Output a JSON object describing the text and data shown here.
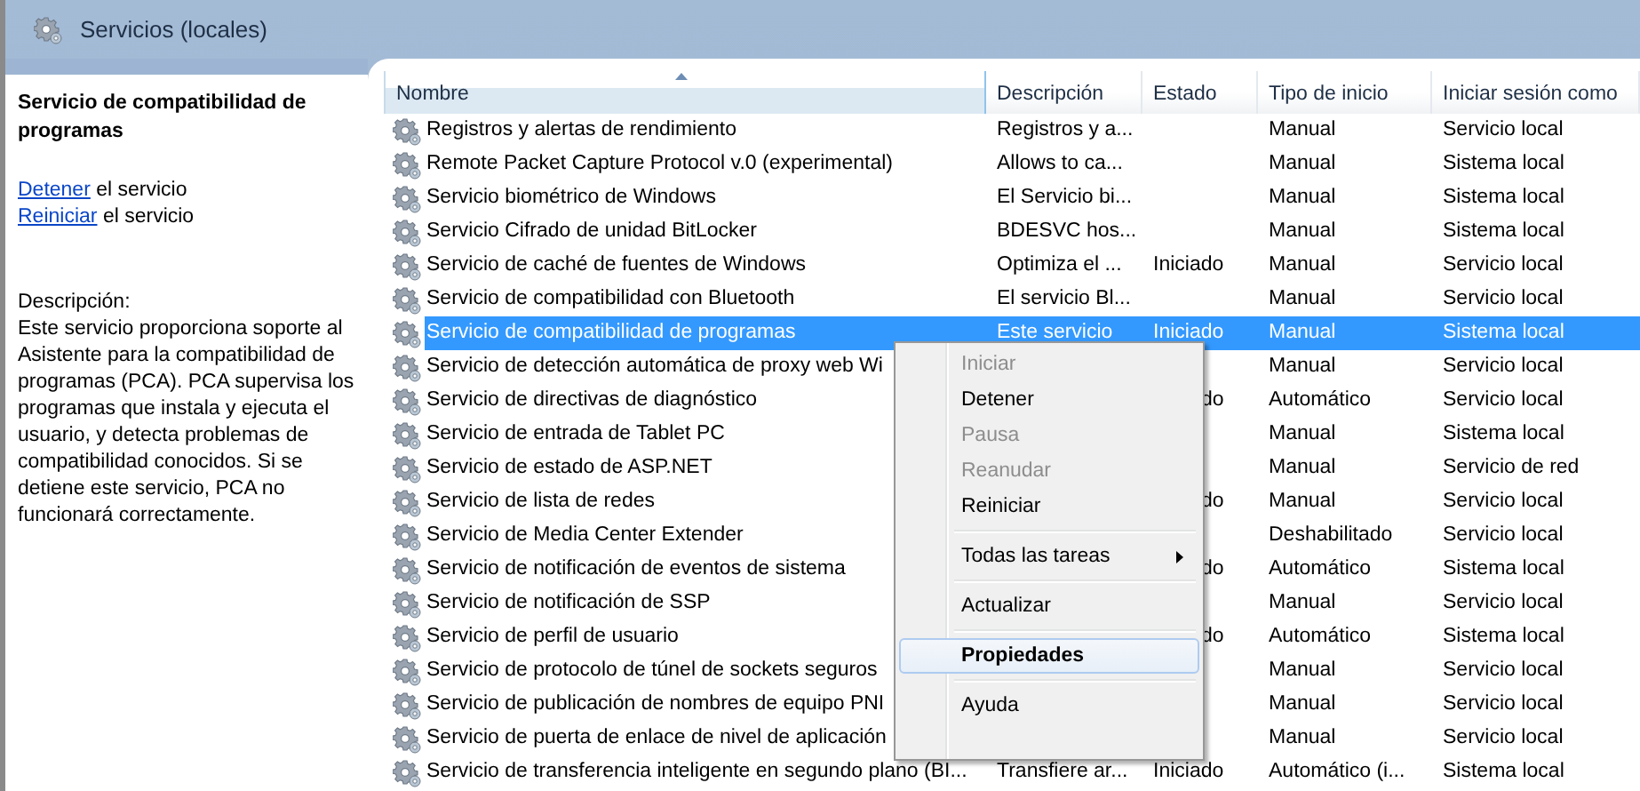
{
  "window": {
    "title": "Servicios (locales)"
  },
  "details": {
    "title": "Servicio de compatibilidad de programas",
    "actions": [
      {
        "link": "Detener",
        "text": "el servicio"
      },
      {
        "link": "Reiniciar",
        "text": "el servicio"
      }
    ],
    "description_label": "Descripción:",
    "description": "Este servicio proporciona soporte al Asistente para la compatibilidad de programas (PCA). PCA supervisa los programas que instala y ejecuta el usuario, y detecta problemas de compatibilidad conocidos. Si se detiene este servicio, PCA no funcionará correctamente."
  },
  "table": {
    "columns": [
      {
        "label": "Nombre",
        "sorted": true
      },
      {
        "label": "Descripción",
        "sorted": false
      },
      {
        "label": "Estado",
        "sorted": false
      },
      {
        "label": "Tipo de inicio",
        "sorted": false
      },
      {
        "label": "Iniciar sesión como",
        "sorted": false
      }
    ],
    "rows": [
      {
        "name": "Registros y alertas de rendimiento",
        "description": "Registros y a...",
        "startup": "Manual",
        "logon": "Servicio local",
        "selected": false
      },
      {
        "name": "Remote Packet Capture Protocol v.0 (experimental)",
        "description": "Allows to ca...",
        "startup": "Manual",
        "logon": "Sistema local",
        "selected": false
      },
      {
        "name": "Servicio biométrico de Windows",
        "description": "El Servicio bi...",
        "startup": "Manual",
        "logon": "Sistema local",
        "selected": false
      },
      {
        "name": "Servicio Cifrado de unidad BitLocker",
        "description": "BDESVC hos...",
        "startup": "Manual",
        "logon": "Sistema local",
        "selected": false
      },
      {
        "name": "Servicio de caché de fuentes de Windows",
        "description": "Optimiza el ...",
        "status": "Iniciado",
        "startup": "Manual",
        "logon": "Servicio local",
        "selected": false
      },
      {
        "name": "Servicio de compatibilidad con Bluetooth",
        "description": "El servicio Bl...",
        "startup": "Manual",
        "logon": "Servicio local",
        "selected": false
      },
      {
        "name": "Servicio de compatibilidad de programas",
        "description": "Este servicio",
        "status": "Iniciado",
        "startup": "Manual",
        "logon": "Sistema local",
        "selected": true
      },
      {
        "name": "Servicio de detección automática de proxy web Wi",
        "startup": "Manual",
        "logon": "Servicio local",
        "selected": false
      },
      {
        "name": "Servicio de directivas de diagnóstico",
        "status_end": "do",
        "startup": "Automático",
        "logon": "Servicio local",
        "selected": false
      },
      {
        "name": "Servicio de entrada de Tablet PC",
        "startup": "Manual",
        "logon": "Sistema local",
        "selected": false
      },
      {
        "name": "Servicio de estado de ASP.NET",
        "startup": "Manual",
        "logon": "Servicio de red",
        "selected": false
      },
      {
        "name": "Servicio de lista de redes",
        "status_end": "do",
        "startup": "Manual",
        "logon": "Servicio local",
        "selected": false
      },
      {
        "name": "Servicio de Media Center Extender",
        "startup": "Deshabilitado",
        "logon": "Servicio local",
        "selected": false
      },
      {
        "name": "Servicio de notificación de eventos de sistema",
        "status_end": "do",
        "startup": "Automático",
        "logon": "Sistema local",
        "selected": false
      },
      {
        "name": "Servicio de notificación de SSP",
        "startup": "Manual",
        "logon": "Servicio local",
        "selected": false
      },
      {
        "name": "Servicio de perfil de usuario",
        "status_end": "do",
        "startup": "Automático",
        "logon": "Sistema local",
        "selected": false
      },
      {
        "name": "Servicio de protocolo de túnel de sockets seguros",
        "startup": "Manual",
        "logon": "Servicio local",
        "selected": false
      },
      {
        "name": "Servicio de publicación de nombres de equipo PNI",
        "startup": "Manual",
        "logon": "Servicio local",
        "selected": false
      },
      {
        "name": "Servicio de puerta de enlace de nivel de aplicación",
        "startup": "Manual",
        "logon": "Servicio local",
        "selected": false
      },
      {
        "name": "Servicio de transferencia inteligente en segundo plano (BI...",
        "description": "Transfiere ar...",
        "status": "Iniciado",
        "startup": "Automático (i...",
        "logon": "Sistema local",
        "selected": false
      }
    ]
  },
  "context_menu": {
    "groups": [
      [
        {
          "label": "Iniciar",
          "disabled": true,
          "default": false,
          "highlighted": false,
          "submenu": false
        },
        {
          "label": "Detener",
          "disabled": false,
          "default": false,
          "highlighted": false,
          "submenu": false
        },
        {
          "label": "Pausa",
          "disabled": true,
          "default": false,
          "highlighted": false,
          "submenu": false
        },
        {
          "label": "Reanudar",
          "disabled": true,
          "default": false,
          "highlighted": false,
          "submenu": false
        },
        {
          "label": "Reiniciar",
          "disabled": false,
          "default": false,
          "highlighted": false,
          "submenu": false
        }
      ],
      [
        {
          "label": "Todas las tareas",
          "disabled": false,
          "default": false,
          "highlighted": false,
          "submenu": true
        }
      ],
      [
        {
          "label": "Actualizar",
          "disabled": false,
          "default": false,
          "highlighted": false,
          "submenu": false
        }
      ],
      [
        {
          "label": "Propiedades",
          "disabled": false,
          "default": true,
          "highlighted": true,
          "submenu": false
        }
      ],
      [
        {
          "label": "Ayuda",
          "disabled": false,
          "default": false,
          "highlighted": false,
          "submenu": false
        }
      ]
    ]
  }
}
